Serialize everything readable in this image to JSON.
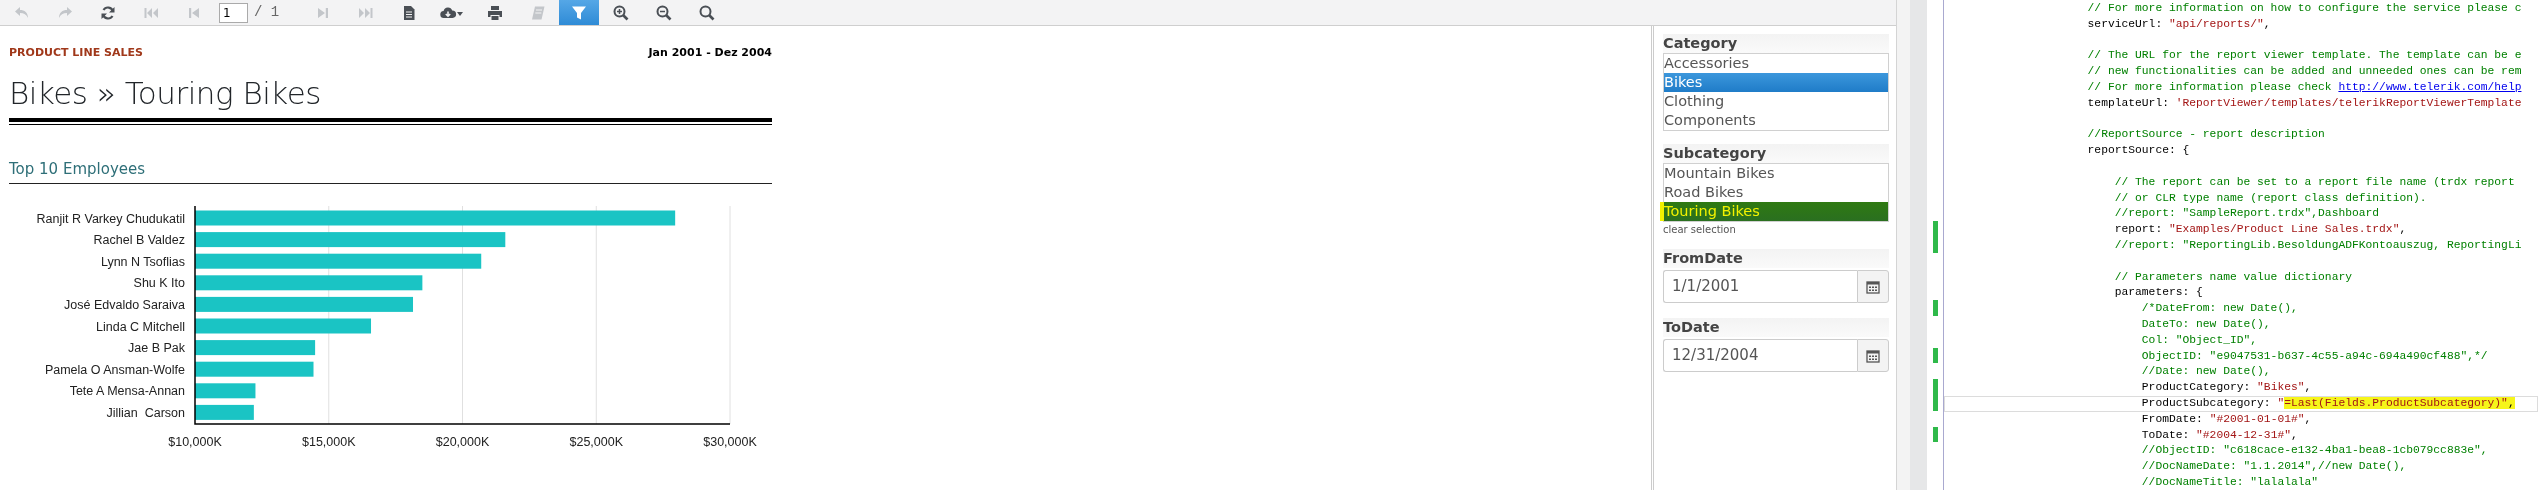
{
  "toolbar": {
    "buttons": [
      {
        "kind": "undo",
        "disabled": true,
        "selected": false
      },
      {
        "kind": "redo",
        "disabled": true,
        "selected": false
      },
      {
        "kind": "refresh",
        "disabled": false,
        "selected": false
      },
      {
        "kind": "first",
        "disabled": true,
        "selected": false
      },
      {
        "kind": "prev",
        "disabled": true,
        "selected": false
      },
      {
        "kind": "page",
        "value": "1",
        "total": "/ 1"
      },
      {
        "kind": "next",
        "disabled": true,
        "selected": false
      },
      {
        "kind": "last",
        "disabled": true,
        "selected": false
      },
      {
        "kind": "document",
        "disabled": false,
        "selected": false
      },
      {
        "kind": "export",
        "disabled": false,
        "selected": false
      },
      {
        "kind": "print",
        "disabled": false,
        "selected": false
      },
      {
        "kind": "book",
        "disabled": true,
        "selected": false
      },
      {
        "kind": "filter",
        "disabled": false,
        "selected": true
      },
      {
        "kind": "zoom-in",
        "disabled": false,
        "selected": false
      },
      {
        "kind": "zoom-out",
        "disabled": false,
        "selected": false
      },
      {
        "kind": "search",
        "disabled": false,
        "selected": false
      }
    ]
  },
  "report": {
    "section_label": "PRODUCT LINE SALES",
    "date_range": "Jan 2001 - Dez 2004",
    "title": "Bikes » Touring Bikes",
    "chart_title": "Top 10 Employees",
    "chart_data": {
      "type": "bar",
      "orientation": "horizontal",
      "categories": [
        "Ranjit R Varkey Chudukatil",
        "Rachel B Valdez",
        "Lynn N Tsoflias",
        "Shu K Ito",
        "José Edvaldo Saraiva",
        "Linda C Mitchell",
        "Jae B Pak",
        "Pamela O Ansman-Wolfe",
        "Tete A Mensa-Annan",
        "Jillian  Carson"
      ],
      "grid": true,
      "series": [
        {
          "color": "#1ac4c4",
          "values": [
            27950,
            21600,
            20700,
            18500,
            18150,
            16580,
            14490,
            14430,
            12260,
            12200
          ]
        }
      ],
      "xlim": [
        10000,
        30000
      ],
      "xticks": [
        {
          "value": 10000,
          "label": "$10,000K"
        },
        {
          "value": 15000,
          "label": "$15,000K"
        },
        {
          "value": 20000,
          "label": "$20,000K"
        },
        {
          "value": 25000,
          "label": "$25,000K"
        },
        {
          "value": 30000,
          "label": "$30,000K"
        }
      ]
    }
  },
  "parameters": [
    {
      "kind": "list",
      "label": "Category",
      "items": [
        {
          "text": "Accessories",
          "selected": false,
          "highlighted": false
        },
        {
          "text": "Bikes",
          "selected": true,
          "highlighted": false
        },
        {
          "text": "Clothing",
          "selected": false,
          "highlighted": false
        },
        {
          "text": "Components",
          "selected": false,
          "highlighted": false
        }
      ]
    },
    {
      "kind": "list",
      "label": "Subcategory",
      "items": [
        {
          "text": "Mountain Bikes",
          "selected": false,
          "highlighted": false
        },
        {
          "text": "Road Bikes",
          "selected": false,
          "highlighted": false
        },
        {
          "text": "Touring Bikes",
          "selected": true,
          "highlighted": true
        }
      ],
      "clear_link": "clear selection"
    },
    {
      "kind": "date",
      "label": "FromDate",
      "value": "1/1/2001"
    },
    {
      "kind": "date",
      "label": "ToDate",
      "value": "12/31/2004"
    }
  ],
  "code_editor": {
    "lines": [
      {
        "kind": "code",
        "modified": false,
        "current": false,
        "segments": [
          {
            "kind": "comment",
            "text": "                    // For more information on how to configure the service please c",
            "highlighted": false
          }
        ]
      },
      {
        "kind": "code",
        "modified": false,
        "current": false,
        "segments": [
          {
            "kind": "plain",
            "text": "                    serviceUrl: ",
            "highlighted": false
          },
          {
            "kind": "string",
            "text": "\"api/reports/\"",
            "highlighted": false
          },
          {
            "kind": "plain",
            "text": ",",
            "highlighted": false
          }
        ]
      },
      {
        "kind": "blank"
      },
      {
        "kind": "code",
        "modified": false,
        "current": false,
        "segments": [
          {
            "kind": "comment",
            "text": "                    // The URL for the report viewer template. The template can be e",
            "highlighted": false
          }
        ]
      },
      {
        "kind": "code",
        "modified": false,
        "current": false,
        "segments": [
          {
            "kind": "comment",
            "text": "                    // new functionalities can be added and unneeded ones can be rem",
            "highlighted": false
          }
        ]
      },
      {
        "kind": "code",
        "modified": false,
        "current": false,
        "segments": [
          {
            "kind": "comment",
            "text": "                    // For more information please check ",
            "highlighted": false
          },
          {
            "kind": "link",
            "text": "http://www.telerik.com/help",
            "highlighted": false
          }
        ]
      },
      {
        "kind": "code",
        "modified": false,
        "current": false,
        "segments": [
          {
            "kind": "plain",
            "text": "                    templateUrl: ",
            "highlighted": false
          },
          {
            "kind": "string",
            "text": "'ReportViewer/templates/telerikReportViewerTemplate",
            "highlighted": false
          }
        ]
      },
      {
        "kind": "blank"
      },
      {
        "kind": "code",
        "modified": false,
        "current": false,
        "segments": [
          {
            "kind": "comment",
            "text": "                    //ReportSource - report description",
            "highlighted": false
          }
        ]
      },
      {
        "kind": "code",
        "modified": false,
        "current": false,
        "segments": [
          {
            "kind": "plain",
            "text": "                    reportSource: {",
            "highlighted": false
          }
        ]
      },
      {
        "kind": "blank"
      },
      {
        "kind": "code",
        "modified": false,
        "current": false,
        "segments": [
          {
            "kind": "comment",
            "text": "                        // The report can be set to a report file name (trdx report",
            "highlighted": false
          }
        ]
      },
      {
        "kind": "code",
        "modified": false,
        "current": false,
        "segments": [
          {
            "kind": "comment",
            "text": "                        // or CLR type name (report class definition).",
            "highlighted": false
          }
        ]
      },
      {
        "kind": "code",
        "modified": false,
        "current": false,
        "segments": [
          {
            "kind": "comment",
            "text": "                        //report: \"SampleReport.trdx\",Dashboard",
            "highlighted": false
          }
        ]
      },
      {
        "kind": "code",
        "modified": true,
        "current": false,
        "segments": [
          {
            "kind": "plain",
            "text": "                        report: ",
            "highlighted": false
          },
          {
            "kind": "string",
            "text": "\"Examples/Product Line Sales.trdx\"",
            "highlighted": false
          },
          {
            "kind": "plain",
            "text": ",",
            "highlighted": false
          }
        ]
      },
      {
        "kind": "code",
        "modified": true,
        "current": false,
        "segments": [
          {
            "kind": "comment",
            "text": "                        //report: \"ReportingLib.BesoldungADFKontoauszug, ReportingLi",
            "highlighted": false
          }
        ]
      },
      {
        "kind": "blank"
      },
      {
        "kind": "code",
        "modified": false,
        "current": false,
        "segments": [
          {
            "kind": "comment",
            "text": "                        // Parameters name value dictionary",
            "highlighted": false
          }
        ]
      },
      {
        "kind": "code",
        "modified": false,
        "current": false,
        "segments": [
          {
            "kind": "plain",
            "text": "                        parameters: {",
            "highlighted": false
          }
        ]
      },
      {
        "kind": "code",
        "modified": true,
        "current": false,
        "segments": [
          {
            "kind": "comment",
            "text": "                            /*DateFrom: new Date(),",
            "highlighted": false
          }
        ]
      },
      {
        "kind": "code",
        "modified": false,
        "current": false,
        "segments": [
          {
            "kind": "comment",
            "text": "                            DateTo: new Date(),",
            "highlighted": false
          }
        ]
      },
      {
        "kind": "code",
        "modified": false,
        "current": false,
        "segments": [
          {
            "kind": "comment",
            "text": "                            Col: \"Object_ID\",",
            "highlighted": false
          }
        ]
      },
      {
        "kind": "code",
        "modified": true,
        "current": false,
        "segments": [
          {
            "kind": "comment",
            "text": "                            ObjectID: \"e9047531-b637-4c55-a94c-694a490cf488\",*/",
            "highlighted": false
          }
        ]
      },
      {
        "kind": "code",
        "modified": false,
        "current": false,
        "segments": [
          {
            "kind": "comment",
            "text": "                            //Date: new Date(),",
            "highlighted": false
          }
        ]
      },
      {
        "kind": "code",
        "modified": true,
        "current": false,
        "segments": [
          {
            "kind": "plain",
            "text": "                            ProductCategory: ",
            "highlighted": false
          },
          {
            "kind": "string",
            "text": "\"Bikes\"",
            "highlighted": false
          },
          {
            "kind": "plain",
            "text": ",",
            "highlighted": false
          }
        ]
      },
      {
        "kind": "code",
        "modified": true,
        "current": true,
        "segments": [
          {
            "kind": "plain",
            "text": "                            ProductSubcategory: ",
            "highlighted": false
          },
          {
            "kind": "string",
            "text": "\"",
            "highlighted": false
          },
          {
            "kind": "string",
            "text": "=Last(Fields.ProductSubcategory)\"",
            "highlighted": true
          },
          {
            "kind": "plain",
            "text": ",",
            "highlighted": true
          }
        ]
      },
      {
        "kind": "code",
        "modified": false,
        "current": false,
        "segments": [
          {
            "kind": "plain",
            "text": "                            FromDate: ",
            "highlighted": false
          },
          {
            "kind": "string",
            "text": "\"#2001-01-01#\"",
            "highlighted": false
          },
          {
            "kind": "plain",
            "text": ",",
            "highlighted": false
          }
        ]
      },
      {
        "kind": "code",
        "modified": true,
        "current": false,
        "segments": [
          {
            "kind": "plain",
            "text": "                            ToDate: ",
            "highlighted": false
          },
          {
            "kind": "string",
            "text": "\"#2004-12-31#\"",
            "highlighted": false
          },
          {
            "kind": "plain",
            "text": ",",
            "highlighted": false
          }
        ]
      },
      {
        "kind": "code",
        "modified": false,
        "current": false,
        "segments": [
          {
            "kind": "comment",
            "text": "                            //ObjectID: \"c618cace-e132-4ba1-bea8-1cb079cc883e\",",
            "highlighted": false
          }
        ]
      },
      {
        "kind": "code",
        "modified": false,
        "current": false,
        "segments": [
          {
            "kind": "comment",
            "text": "                            //DocNameDate: \"1.1.2014\",//new Date(),",
            "highlighted": false
          }
        ]
      },
      {
        "kind": "code",
        "modified": false,
        "current": false,
        "segments": [
          {
            "kind": "comment",
            "text": "                            //DocNameTitle: \"lalalala\"",
            "highlighted": false
          }
        ]
      }
    ]
  }
}
